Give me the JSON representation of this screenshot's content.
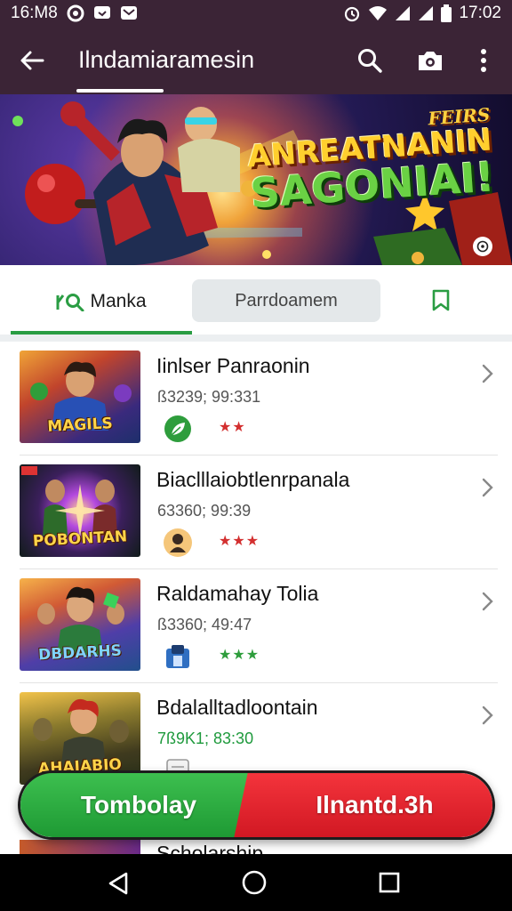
{
  "status_bar": {
    "time": "16:M8",
    "clock": "17:02",
    "left_icons": [
      "settings-circle-icon",
      "message-icon",
      "mail-icon"
    ],
    "right_icons": [
      "alarm-icon",
      "wifi-icon",
      "signal-icon",
      "signal-icon",
      "battery-icon"
    ]
  },
  "app_bar": {
    "title": "Ilndamiaramesin",
    "colors": {
      "background": "#3b2436",
      "foreground": "#ffffff"
    }
  },
  "banner": {
    "small_text": "FEIRS",
    "line1": "ANREATNANIN",
    "line2": "SAGONIAI!"
  },
  "tabs": [
    {
      "label": "Manka",
      "icon": "leaf-search-icon",
      "selected": true
    },
    {
      "label": "Parrdoamem",
      "selected": false
    },
    {
      "icon": "bookmark-icon"
    }
  ],
  "list": [
    {
      "title": "Iinlser Panraonin",
      "meta": "ß3239; 99:331",
      "meta_color": "gray",
      "badge_icon": "green-leaf-badge-icon",
      "stars": "★★",
      "star_color": "#d32f2f",
      "thumb_caption": "MAGILS"
    },
    {
      "title": "Biaclllaiobtlenrpanala",
      "meta": "63360; 99:39",
      "meta_color": "gray",
      "badge_icon": "hero-avatar-icon",
      "stars": "★★★",
      "star_color": "#d32f2f",
      "thumb_caption": "POBONTAN"
    },
    {
      "title": "Raldamahay Tolia",
      "meta": "ß3360; 49:47",
      "meta_color": "gray",
      "badge_icon": "blue-cube-icon",
      "stars": "★★★",
      "star_color": "#2e9d3c",
      "thumb_caption": "DBDARHS"
    },
    {
      "title": "Bdalalltadloontain",
      "meta": "7ß9K1; 83:30",
      "meta_color": "green",
      "badge_icon": "doc-icon",
      "stars": "",
      "star_color": "#2e9d3c",
      "thumb_caption": "AHAJABIO"
    }
  ],
  "next_item_peek": "Scholarship",
  "split_button": {
    "left_label": "Tombolay",
    "right_label": "Ilnantd.3h",
    "left_color": "#2aa843",
    "right_color": "#e3222b"
  },
  "nav_bar": {
    "icons": [
      "back-triangle-icon",
      "home-circle-icon",
      "recents-square-icon"
    ]
  }
}
